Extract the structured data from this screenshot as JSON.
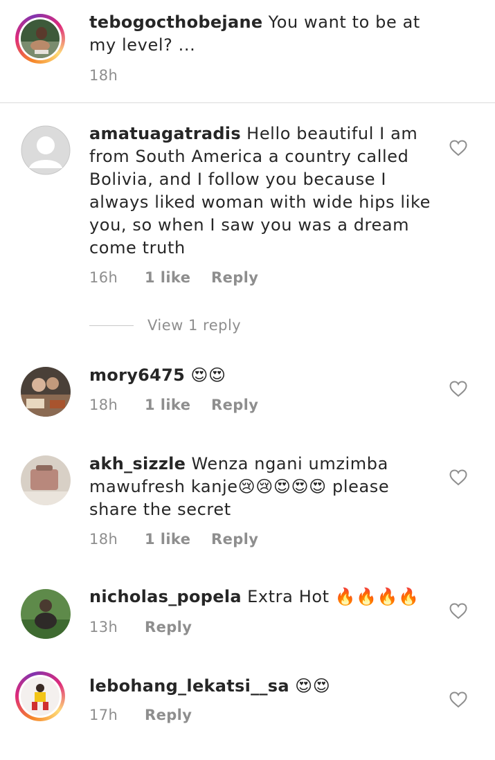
{
  "caption": {
    "username": "tebogocthobejane",
    "text": "You want to be at my level? ...",
    "time": "18h"
  },
  "comments": [
    {
      "username": "amatuagatradis",
      "text": "Hello beautiful I am from South America a country called Bolivia, and I follow you because I always liked woman with wide hips like you, so when I saw you was a dream come truth",
      "time": "16h",
      "likes": "1 like",
      "reply": "Reply",
      "view_replies": "View 1 reply"
    },
    {
      "username": "mory6475",
      "text": "😍😍",
      "time": "18h",
      "likes": "1 like",
      "reply": "Reply"
    },
    {
      "username": "akh_sizzle",
      "text": "Wenza ngani umzimba mawufresh kanje😢😢😍😍😍 please share the secret",
      "time": "18h",
      "likes": "1 like",
      "reply": "Reply"
    },
    {
      "username": "nicholas_popela",
      "text": "Extra Hot 🔥🔥🔥🔥",
      "time": "13h",
      "reply": "Reply"
    },
    {
      "username": "lebohang_lekatsi__sa",
      "text": "😍😍",
      "time": "17h",
      "reply": "Reply"
    }
  ],
  "icons": {
    "like": "heart-outline-icon",
    "default_avatar": "person-placeholder-icon"
  },
  "colors": {
    "text": "#262626",
    "secondary": "#8e8e8e",
    "divider": "#dbdbdb",
    "story_ring_start": "#f58529",
    "story_ring_mid": "#dd2a7b",
    "story_ring_end": "#8134af"
  }
}
